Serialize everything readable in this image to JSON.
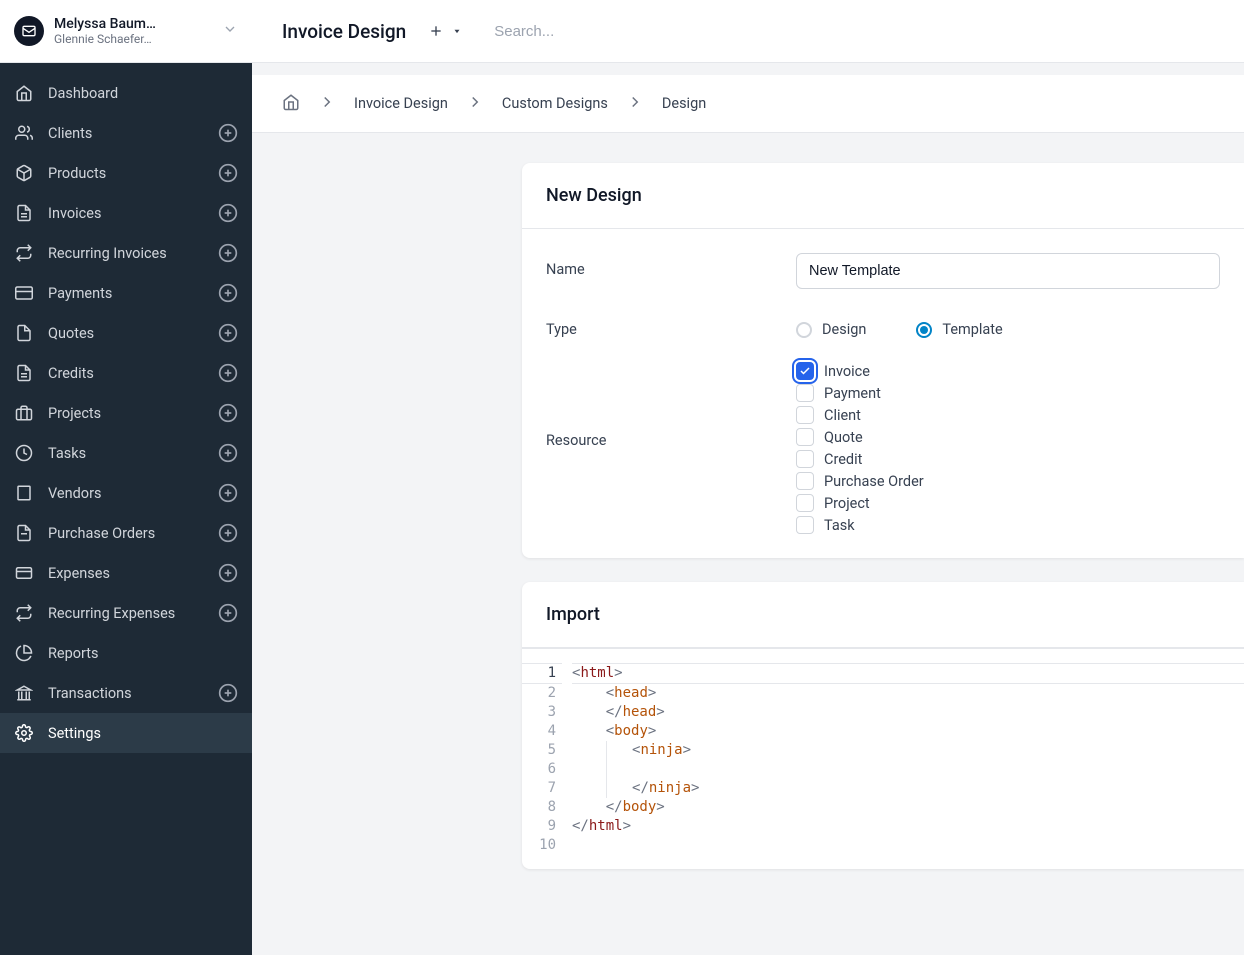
{
  "user": {
    "primary": "Melyssa Baum…",
    "secondary": "Glennie Schaefer…"
  },
  "sidebar": {
    "items": [
      {
        "label": "Dashboard",
        "add": false
      },
      {
        "label": "Clients",
        "add": true
      },
      {
        "label": "Products",
        "add": true
      },
      {
        "label": "Invoices",
        "add": true
      },
      {
        "label": "Recurring Invoices",
        "add": true
      },
      {
        "label": "Payments",
        "add": true
      },
      {
        "label": "Quotes",
        "add": true
      },
      {
        "label": "Credits",
        "add": true
      },
      {
        "label": "Projects",
        "add": true
      },
      {
        "label": "Tasks",
        "add": true
      },
      {
        "label": "Vendors",
        "add": true
      },
      {
        "label": "Purchase Orders",
        "add": true
      },
      {
        "label": "Expenses",
        "add": true
      },
      {
        "label": "Recurring Expenses",
        "add": true
      },
      {
        "label": "Reports",
        "add": false
      },
      {
        "label": "Transactions",
        "add": true
      },
      {
        "label": "Settings",
        "add": false
      }
    ]
  },
  "topbar": {
    "title": "Invoice Design",
    "search_placeholder": "Search..."
  },
  "breadcrumbs": {
    "items": [
      "Invoice Design",
      "Custom Designs",
      "Design"
    ]
  },
  "new_design": {
    "header": "New Design",
    "name_label": "Name",
    "name_value": "New Template",
    "type_label": "Type",
    "type_options": {
      "design": "Design",
      "template": "Template"
    },
    "resource_label": "Resource",
    "resources": [
      "Invoice",
      "Payment",
      "Client",
      "Quote",
      "Credit",
      "Purchase Order",
      "Project",
      "Task"
    ]
  },
  "import": {
    "header": "Import",
    "lines": [
      "<html>",
      "    <head>",
      "    </head>",
      "    <body>",
      "        <ninja>",
      "",
      "        </ninja>",
      "    </body>",
      "</html>",
      ""
    ]
  }
}
